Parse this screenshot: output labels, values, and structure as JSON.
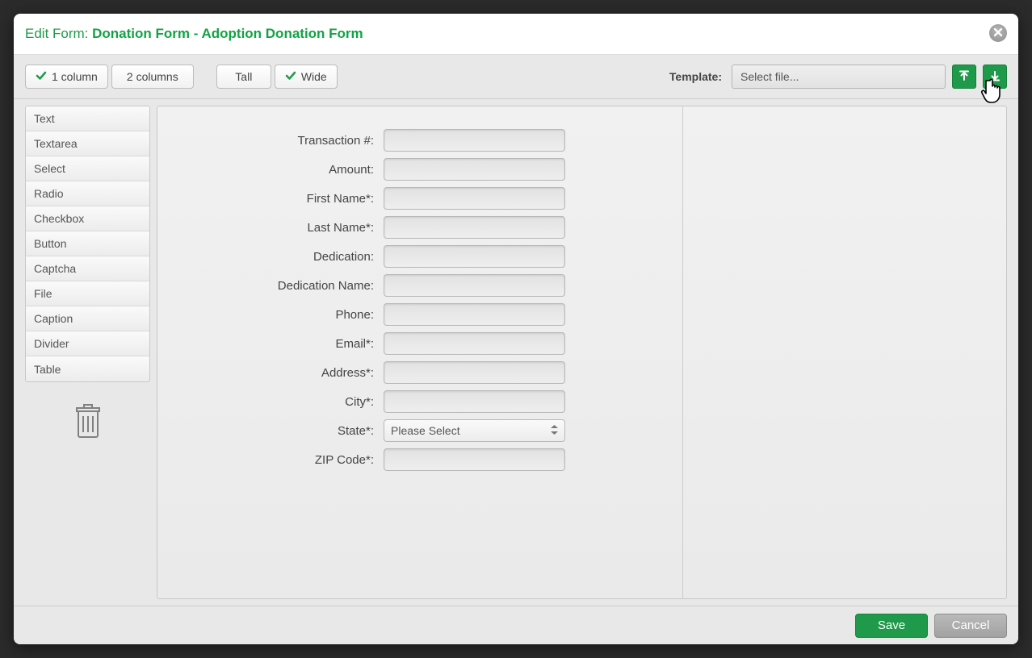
{
  "title": {
    "prefix": "Edit Form: ",
    "name": "Donation Form - Adoption Donation Form"
  },
  "toolbar": {
    "one_col": "1 column",
    "two_col": "2 columns",
    "tall": "Tall",
    "wide": "Wide",
    "template_label": "Template:",
    "template_placeholder": "Select file..."
  },
  "sidebar": {
    "items": [
      "Text",
      "Textarea",
      "Select",
      "Radio",
      "Checkbox",
      "Button",
      "Captcha",
      "File",
      "Caption",
      "Divider",
      "Table"
    ]
  },
  "form": {
    "fields": [
      {
        "label": "Transaction #:",
        "type": "text",
        "value": ""
      },
      {
        "label": "Amount:",
        "type": "text",
        "value": ""
      },
      {
        "label": "First Name*:",
        "type": "text",
        "value": ""
      },
      {
        "label": "Last Name*:",
        "type": "text",
        "value": ""
      },
      {
        "label": "Dedication:",
        "type": "text",
        "value": ""
      },
      {
        "label": "Dedication Name:",
        "type": "text",
        "value": ""
      },
      {
        "label": "Phone:",
        "type": "text",
        "value": ""
      },
      {
        "label": "Email*:",
        "type": "text",
        "value": ""
      },
      {
        "label": "Address*:",
        "type": "text",
        "value": ""
      },
      {
        "label": "City*:",
        "type": "text",
        "value": ""
      },
      {
        "label": "State*:",
        "type": "select",
        "value": "Please Select"
      },
      {
        "label": "ZIP Code*:",
        "type": "text",
        "value": ""
      }
    ]
  },
  "footer": {
    "save": "Save",
    "cancel": "Cancel"
  }
}
